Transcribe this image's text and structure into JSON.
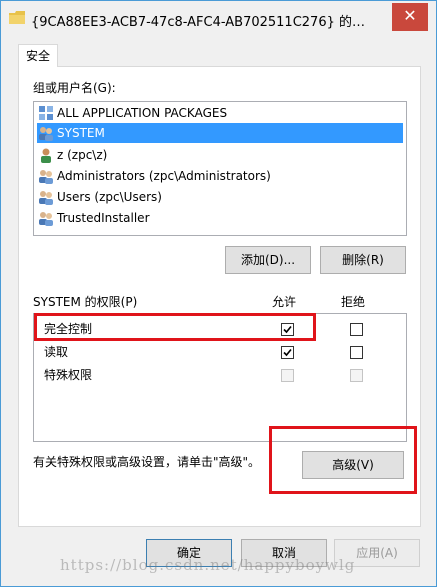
{
  "window": {
    "title": "{9CA88EE3-ACB7-47c8-AFC4-AB702511C276} 的…",
    "close_glyph": "✕"
  },
  "tabs": [
    {
      "label": "安全"
    }
  ],
  "groups": {
    "label": "组或用户名(G):",
    "items": [
      {
        "label": "ALL APPLICATION PACKAGES",
        "icon": "package-icon",
        "selected": false
      },
      {
        "label": "SYSTEM",
        "icon": "users-icon",
        "selected": true
      },
      {
        "label": "z (zpc\\z)",
        "icon": "user-icon",
        "selected": false
      },
      {
        "label": "Administrators (zpc\\Administrators)",
        "icon": "users-icon",
        "selected": false
      },
      {
        "label": "Users (zpc\\Users)",
        "icon": "users-icon",
        "selected": false
      },
      {
        "label": "TrustedInstaller",
        "icon": "users-icon",
        "selected": false
      }
    ],
    "add_label": "添加(D)...",
    "remove_label": "删除(R)"
  },
  "permissions": {
    "label": "SYSTEM 的权限(P)",
    "allow_header": "允许",
    "deny_header": "拒绝",
    "rows": [
      {
        "name": "完全控制",
        "allow": true,
        "deny": false,
        "disabled": false
      },
      {
        "name": "读取",
        "allow": true,
        "deny": false,
        "disabled": false
      },
      {
        "name": "特殊权限",
        "allow": false,
        "deny": false,
        "disabled": true
      }
    ]
  },
  "advanced": {
    "text": "有关特殊权限或高级设置，请单击\"高级\"。",
    "button_label": "高级(V)"
  },
  "footer": {
    "ok_label": "确定",
    "cancel_label": "取消",
    "apply_label": "应用(A)"
  },
  "watermark": "https://blog.csdn.net/happyboywlg",
  "colors": {
    "highlight": "#e0141a",
    "selection": "#3399ff",
    "close": "#c9483c"
  }
}
